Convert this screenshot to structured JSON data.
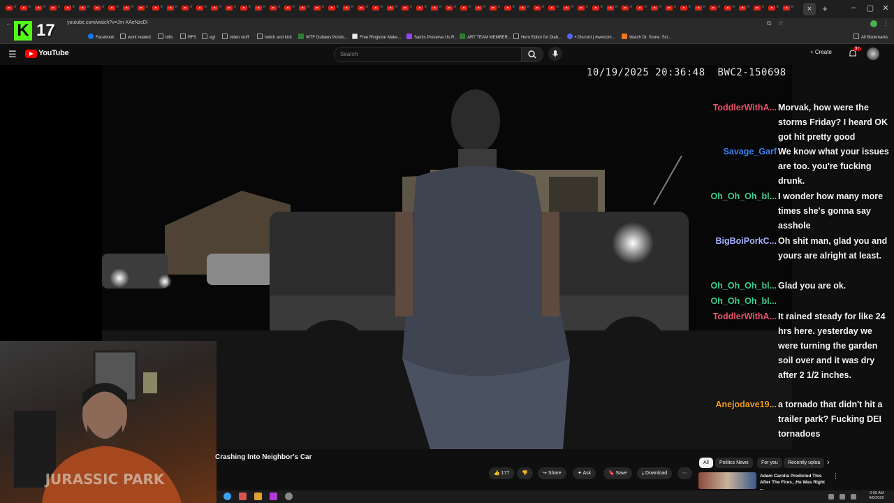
{
  "browser": {
    "tab_count": 54,
    "url": "youtube.com/watch?v=Jm-XAeNzcDI",
    "new_tab_label": "+",
    "close_label": "×",
    "bookmarks": [
      {
        "label": "Facebook"
      },
      {
        "label": "work related"
      },
      {
        "label": "bills"
      },
      {
        "label": "RFS"
      },
      {
        "label": "egl"
      },
      {
        "label": "video stuff"
      },
      {
        "label": "twitch and kick"
      },
      {
        "label": "WTF Outlaws Points..."
      },
      {
        "label": "Free Ringtone Make..."
      },
      {
        "label": "Saints Preserve Us R..."
      },
      {
        "label": "ART TEAM MEMBER..."
      },
      {
        "label": "Hero Editor for Diab..."
      },
      {
        "label": "• Discord | #welcom..."
      },
      {
        "label": "Watch Dr. Stone: Sci..."
      }
    ],
    "all_bookmarks_label": "All Bookmarks"
  },
  "overlay_counter": {
    "letter": "K",
    "value": "17"
  },
  "youtube": {
    "logo_text": "YouTube",
    "search_placeholder": "Search",
    "create_label": "+ Create",
    "notification_badge": "9+"
  },
  "video": {
    "timestamp": "10/19/2025 20:36:48",
    "camera_id": "BWC2-150698",
    "title": "Crashing Into Neighbor's Car"
  },
  "chat": [
    {
      "user": "ToddlerWithA...",
      "color": "#e8536b",
      "text": "Morvak, how were the storms Friday? I heard OK got hit pretty good"
    },
    {
      "user": "Savage_Garf",
      "color": "#3b82f6",
      "text": "We know what your issues are too. you're fucking drunk."
    },
    {
      "user": "Oh_Oh_Oh_bl...",
      "color": "#3fd18f",
      "text": "I wonder how many more times she's gonna say asshole"
    },
    {
      "user": "BigBoiPorkC...",
      "color": "#a9b4ff",
      "text": "Oh shit man, glad you and yours are alright at least."
    },
    {
      "user": "Oh_Oh_Oh_bl...",
      "color": "#3fd18f",
      "text": "Glad you are ok."
    },
    {
      "user": "Oh_Oh_Oh_bl...",
      "color": "#3fd18f",
      "text": ""
    },
    {
      "user": "ToddlerWithA...",
      "color": "#e8536b",
      "text": "It rained steady for like 24 hrs here. yesterday we were turning the garden soil over and it was dry after 2 1/2 inches."
    },
    {
      "user": "Anejodave19...",
      "color": "#f0a020",
      "text": "a tornado that didn't hit a trailer park? Fucking DEI tornadoes"
    }
  ],
  "actions": {
    "likes": "177",
    "share": "Share",
    "ask": "Ask",
    "save": "Save",
    "download": "Download",
    "more": "⋯"
  },
  "chips": [
    "All",
    "Politics News",
    "For you",
    "Recently uploa"
  ],
  "recommendation": {
    "title": "Adam Carolla Predicted This After The Fires...He Was Right ..."
  },
  "webcam": {
    "shirt_text": "JURASSIC PARK"
  },
  "clock": {
    "time": "6:55 AM",
    "date": "4/6/2026"
  }
}
